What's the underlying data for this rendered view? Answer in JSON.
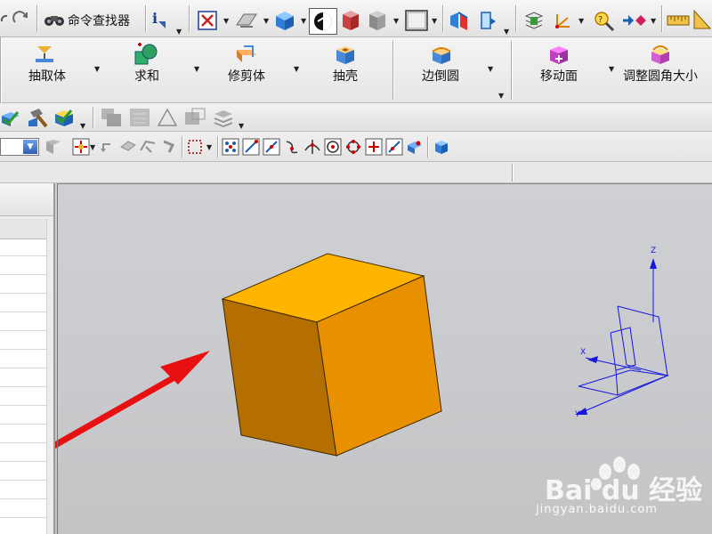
{
  "toolbar_top": {
    "command_finder_label": "命令查找器"
  },
  "feature_buttons": [
    {
      "id": "extract",
      "label": "抽取体"
    },
    {
      "id": "unite",
      "label": "求和"
    },
    {
      "id": "trim",
      "label": "修剪体"
    },
    {
      "id": "shell",
      "label": "抽壳"
    },
    {
      "id": "edge-blend",
      "label": "边倒圆"
    },
    {
      "id": "move-face",
      "label": "移动面"
    },
    {
      "id": "resize-blend",
      "label": "调整圆角大小"
    }
  ],
  "colors": {
    "cube_top": "#ffb400",
    "cube_left": "#b56f00",
    "cube_right": "#e99000",
    "arrow": "#e81010",
    "triad": "#1616e0",
    "viewport_bg": "#cacbce"
  },
  "triad_labels": {
    "z": "Z",
    "x": "X",
    "y": "Y"
  },
  "watermark": {
    "brand": "Bai du 经验",
    "url": "jingyan.baidu.com"
  }
}
